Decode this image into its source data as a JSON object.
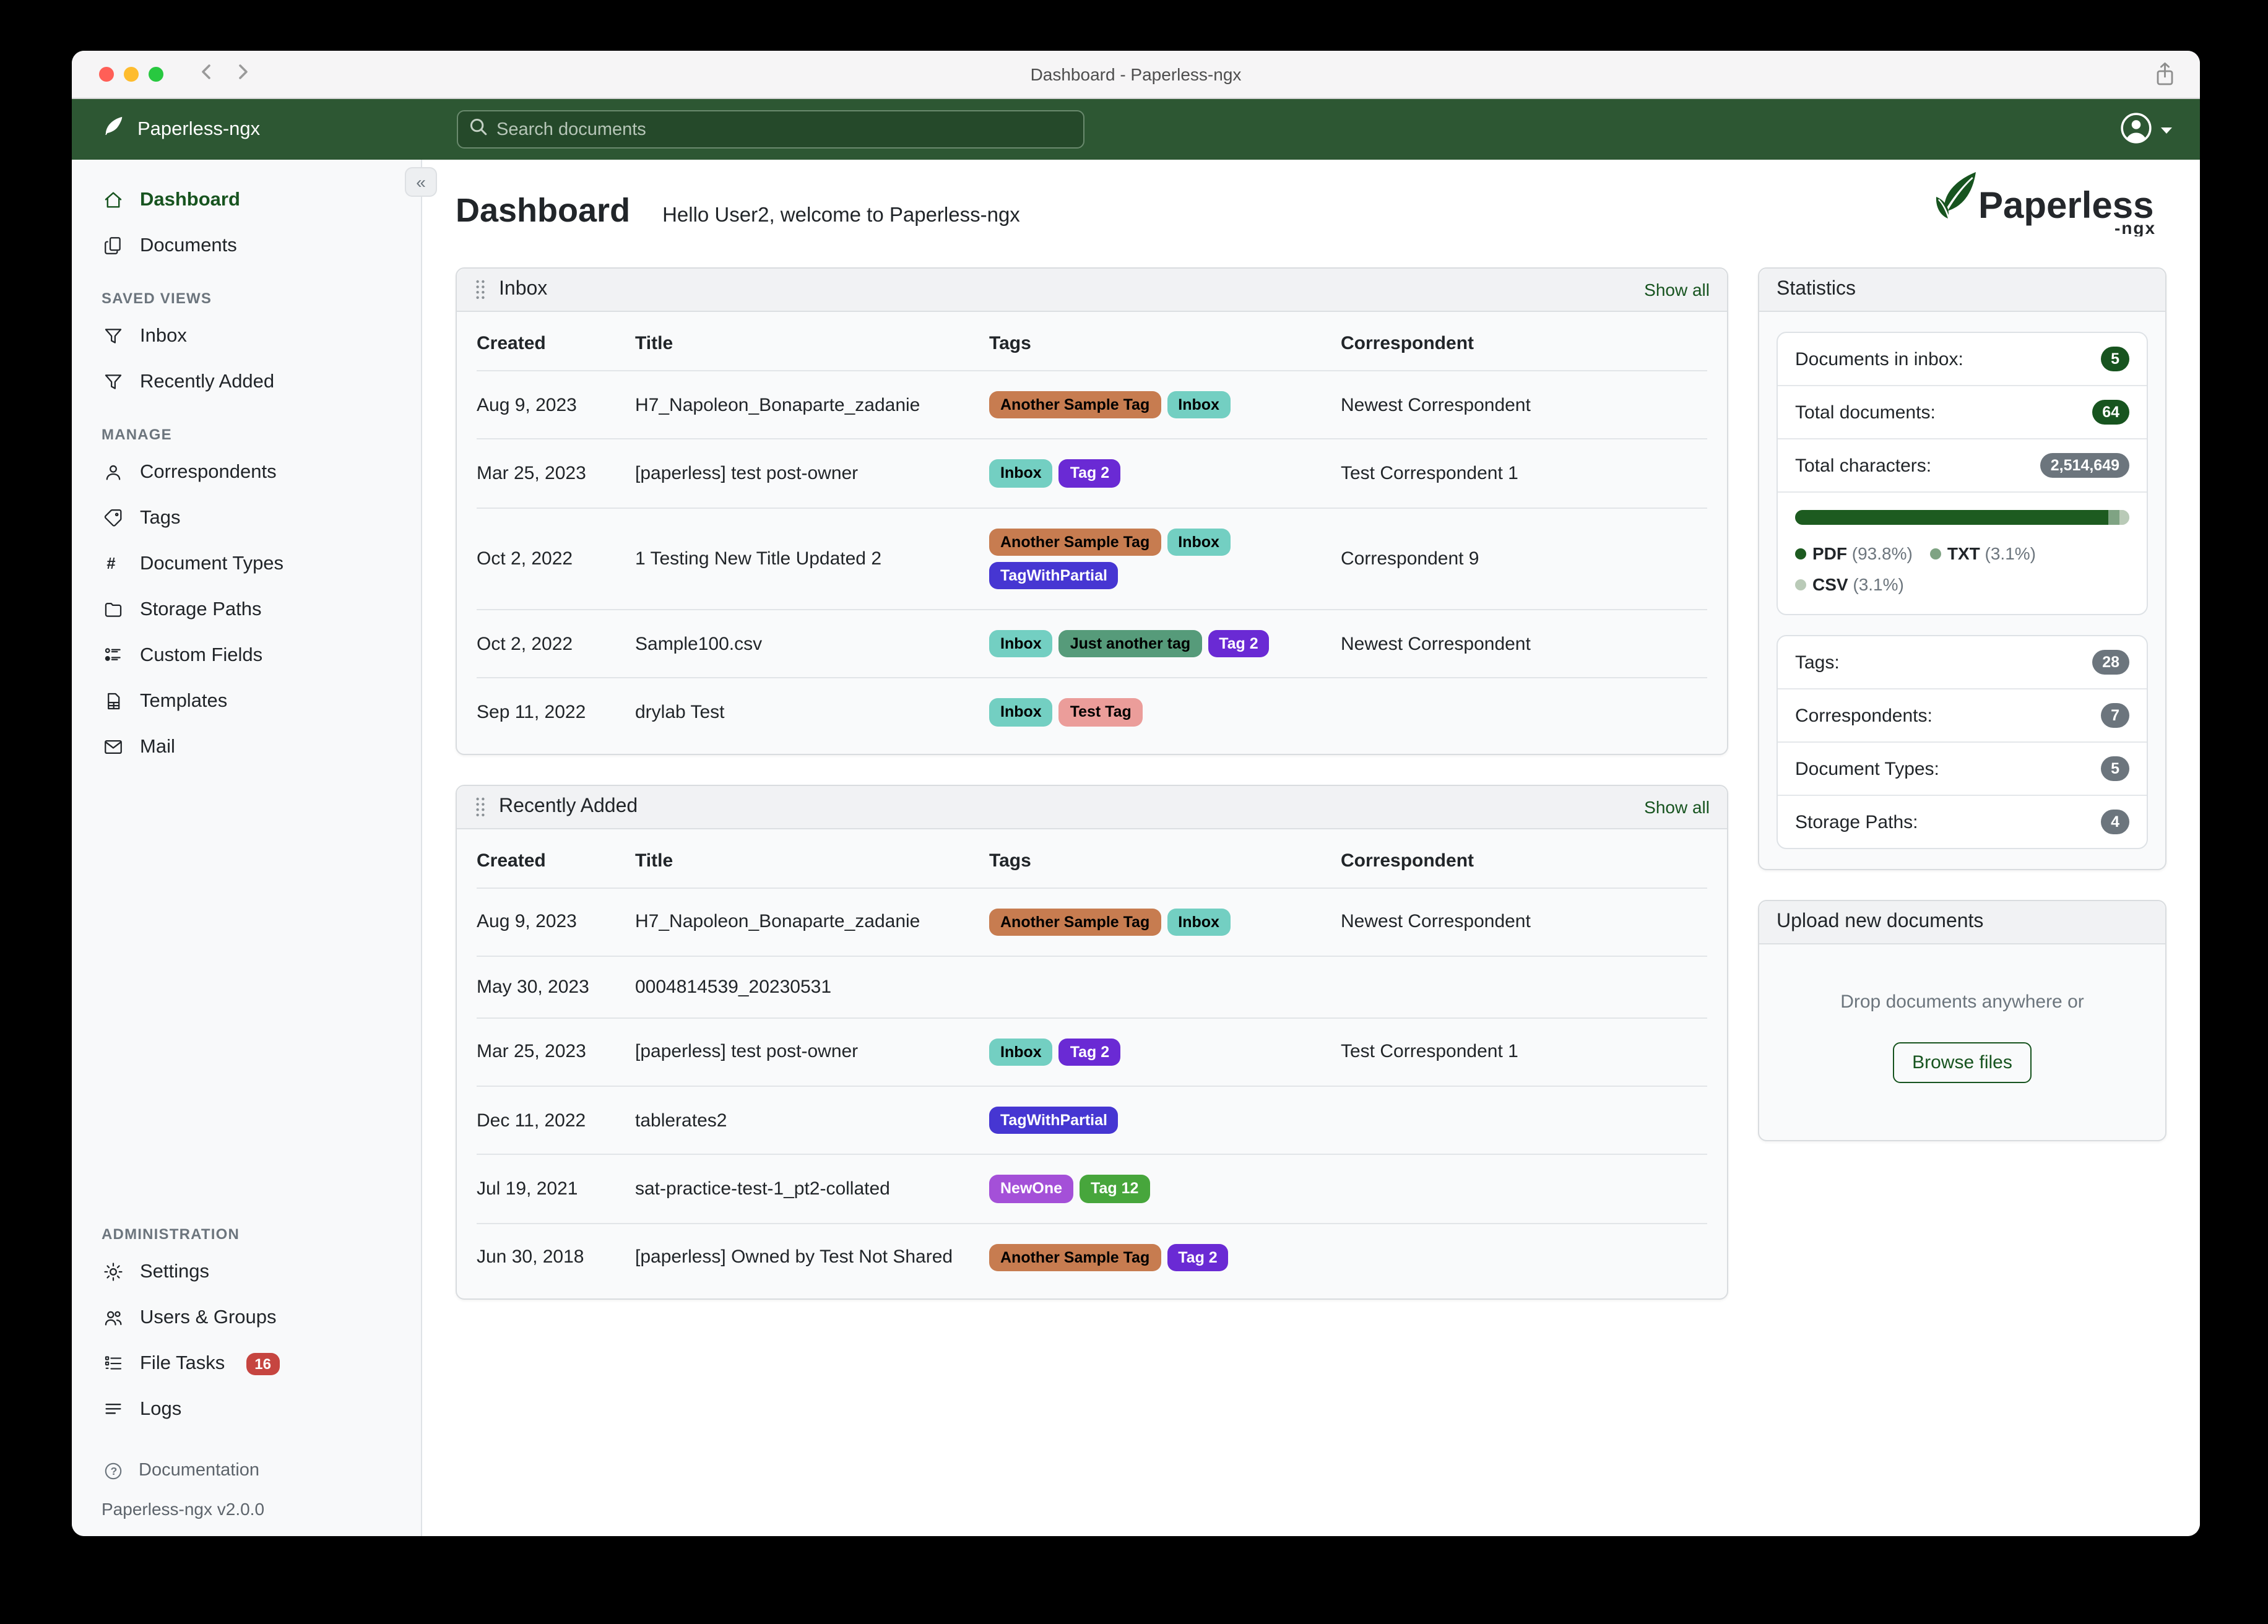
{
  "window": {
    "title": "Dashboard - Paperless-ngx"
  },
  "navbar": {
    "brand": "Paperless-ngx",
    "search_placeholder": "Search documents"
  },
  "colors": {
    "accent": "#17541f",
    "navbar_bg": "#2d5733",
    "search_border": "#6a8a6e",
    "badge_green": "#17541f",
    "badge_gray": "#6c757d",
    "badge_red": "#c64540"
  },
  "sidebar": {
    "items": [
      {
        "label": "Dashboard"
      },
      {
        "label": "Documents"
      }
    ],
    "saved_views_label": "SAVED VIEWS",
    "saved_views": [
      {
        "label": "Inbox"
      },
      {
        "label": "Recently Added"
      }
    ],
    "manage_label": "MANAGE",
    "manage": [
      {
        "label": "Correspondents"
      },
      {
        "label": "Tags"
      },
      {
        "label": "Document Types"
      },
      {
        "label": "Storage Paths"
      },
      {
        "label": "Custom Fields"
      },
      {
        "label": "Templates"
      },
      {
        "label": "Mail"
      }
    ],
    "admin_label": "ADMINISTRATION",
    "admin": [
      {
        "label": "Settings"
      },
      {
        "label": "Users & Groups"
      },
      {
        "label": "File Tasks",
        "badge": "16"
      },
      {
        "label": "Logs"
      }
    ],
    "documentation_label": "Documentation",
    "version": "Paperless-ngx v2.0.0"
  },
  "header": {
    "title": "Dashboard",
    "greeting": "Hello User2, welcome to Paperless-ngx"
  },
  "logo": {
    "text": "Paperless",
    "suffix": "-ngx"
  },
  "tags_palette": {
    "Another Sample Tag": {
      "bg": "#c77c50",
      "fg": "#000000"
    },
    "Inbox": {
      "bg": "#73cfc2",
      "fg": "#000000"
    },
    "Tag 2": {
      "bg": "#6a2ad4",
      "fg": "#ffffff"
    },
    "TagWithPartial": {
      "bg": "#4636d2",
      "fg": "#ffffff"
    },
    "Just another tag": {
      "bg": "#569b7a",
      "fg": "#000000"
    },
    "Test Tag": {
      "bg": "#eb9d9a",
      "fg": "#000000"
    },
    "NewOne": {
      "bg": "#a450d8",
      "fg": "#ffffff"
    },
    "Tag 12": {
      "bg": "#47a63c",
      "fg": "#ffffff"
    }
  },
  "cards": {
    "inbox": {
      "title": "Inbox",
      "show_all": "Show all",
      "columns": [
        "Created",
        "Title",
        "Tags",
        "Correspondent"
      ],
      "rows": [
        {
          "created": "Aug 9, 2023",
          "title": "H7_Napoleon_Bonaparte_zadanie",
          "tags": [
            "Another Sample Tag",
            "Inbox"
          ],
          "correspondent": "Newest Correspondent"
        },
        {
          "created": "Mar 25, 2023",
          "title": "[paperless] test post-owner",
          "tags": [
            "Inbox",
            "Tag 2"
          ],
          "correspondent": "Test Correspondent 1"
        },
        {
          "created": "Oct 2, 2022",
          "title": "1 Testing New Title Updated 2",
          "tags": [
            "Another Sample Tag",
            "Inbox",
            "TagWithPartial"
          ],
          "correspondent": "Correspondent 9"
        },
        {
          "created": "Oct 2, 2022",
          "title": "Sample100.csv",
          "tags": [
            "Inbox",
            "Just another tag",
            "Tag 2"
          ],
          "correspondent": "Newest Correspondent"
        },
        {
          "created": "Sep 11, 2022",
          "title": "drylab Test",
          "tags": [
            "Inbox",
            "Test Tag"
          ],
          "correspondent": ""
        }
      ]
    },
    "recent": {
      "title": "Recently Added",
      "show_all": "Show all",
      "columns": [
        "Created",
        "Title",
        "Tags",
        "Correspondent"
      ],
      "rows": [
        {
          "created": "Aug 9, 2023",
          "title": "H7_Napoleon_Bonaparte_zadanie",
          "tags": [
            "Another Sample Tag",
            "Inbox"
          ],
          "correspondent": "Newest Correspondent"
        },
        {
          "created": "May 30, 2023",
          "title": "0004814539_20230531",
          "tags": [],
          "correspondent": ""
        },
        {
          "created": "Mar 25, 2023",
          "title": "[paperless] test post-owner",
          "tags": [
            "Inbox",
            "Tag 2"
          ],
          "correspondent": "Test Correspondent 1"
        },
        {
          "created": "Dec 11, 2022",
          "title": "tablerates2",
          "tags": [
            "TagWithPartial"
          ],
          "correspondent": ""
        },
        {
          "created": "Jul 19, 2021",
          "title": "sat-practice-test-1_pt2-collated",
          "tags": [
            "NewOne",
            "Tag 12"
          ],
          "correspondent": ""
        },
        {
          "created": "Jun 30, 2018",
          "title": "[paperless] Owned by Test Not Shared",
          "tags": [
            "Another Sample Tag",
            "Tag 2"
          ],
          "correspondent": ""
        }
      ]
    }
  },
  "stats": {
    "title": "Statistics",
    "group1": [
      {
        "label": "Documents in inbox:",
        "value": "5",
        "style": "green"
      },
      {
        "label": "Total documents:",
        "value": "64",
        "style": "green"
      },
      {
        "label": "Total characters:",
        "value": "2,514,649",
        "style": "gray"
      }
    ],
    "file_types": [
      {
        "name": "PDF",
        "pct": 93.8,
        "pct_label": "(93.8%)",
        "color": "#1d5b20"
      },
      {
        "name": "TXT",
        "pct": 3.1,
        "pct_label": "(3.1%)",
        "color": "#7fa383"
      },
      {
        "name": "CSV",
        "pct": 3.1,
        "pct_label": "(3.1%)",
        "color": "#b9cab7"
      }
    ],
    "group2": [
      {
        "label": "Tags:",
        "value": "28",
        "style": "gray"
      },
      {
        "label": "Correspondents:",
        "value": "7",
        "style": "gray"
      },
      {
        "label": "Document Types:",
        "value": "5",
        "style": "gray"
      },
      {
        "label": "Storage Paths:",
        "value": "4",
        "style": "gray"
      }
    ]
  },
  "upload": {
    "title": "Upload new documents",
    "drop_text": "Drop documents anywhere or",
    "browse_label": "Browse files"
  }
}
